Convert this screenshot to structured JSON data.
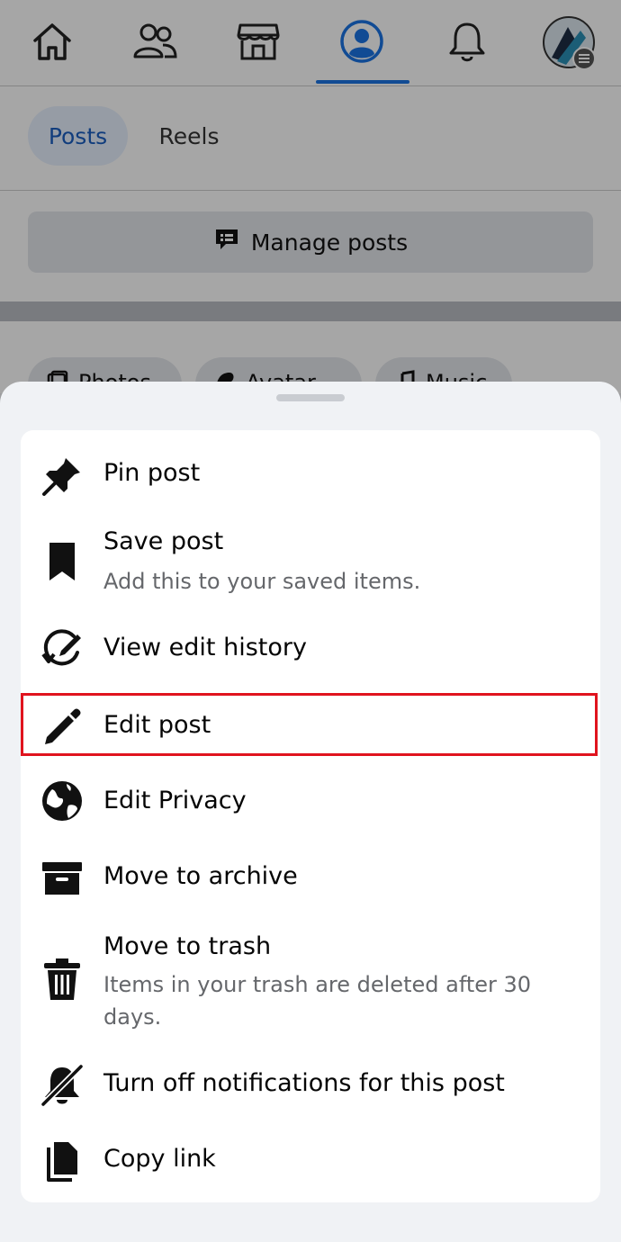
{
  "nav": {
    "items": [
      "home-icon",
      "friends-icon",
      "marketplace-icon",
      "profile-icon",
      "bell-icon",
      "avatar-menu"
    ],
    "active": "profile-icon",
    "accent": "#1b74e4"
  },
  "tabs": {
    "posts": "Posts",
    "reels": "Reels"
  },
  "manage": {
    "label": "Manage posts"
  },
  "filters": {
    "photos": "Photos",
    "avatar": "Avatar",
    "music": "Music"
  },
  "sheet": {
    "items": [
      {
        "icon": "pin-icon",
        "title": "Pin post"
      },
      {
        "icon": "bookmark-icon",
        "title": "Save post",
        "subtitle": "Add this to your saved items."
      },
      {
        "icon": "edit-history-icon",
        "title": "View edit history"
      },
      {
        "icon": "pencil-icon",
        "title": "Edit post",
        "highlighted": true
      },
      {
        "icon": "globe-icon",
        "title": "Edit Privacy"
      },
      {
        "icon": "archive-icon",
        "title": "Move to archive"
      },
      {
        "icon": "trash-icon",
        "title": "Move to trash",
        "subtitle": "Items in your trash are deleted after 30 days."
      },
      {
        "icon": "bell-off-icon",
        "title": "Turn off notifications for this post"
      },
      {
        "icon": "copy-icon",
        "title": "Copy link"
      }
    ],
    "highlight_color": "#e0141e"
  }
}
